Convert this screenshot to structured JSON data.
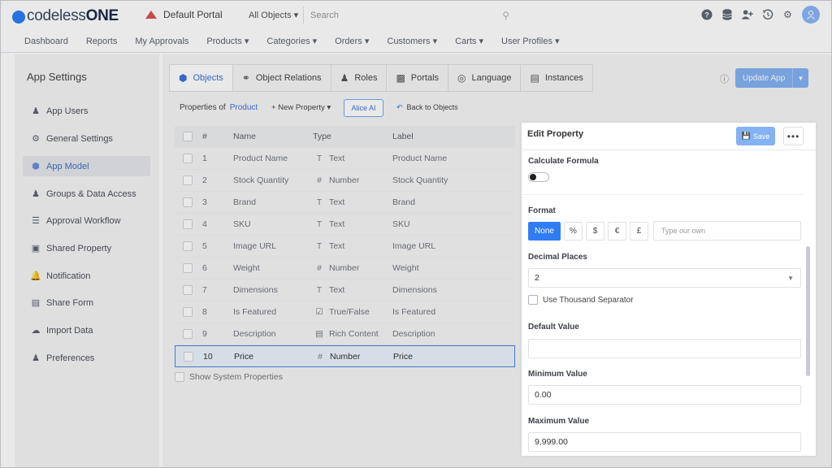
{
  "topbar": {
    "logo_prefix": "codeless",
    "logo_suffix": "ONE",
    "portal": "Default Portal",
    "object_selector": "All Objects ▾",
    "search_placeholder": "Search"
  },
  "nav": [
    "Dashboard",
    "Reports",
    "My Approvals",
    "Products ▾",
    "Categories ▾",
    "Orders ▾",
    "Customers ▾",
    "Carts ▾",
    "User Profiles ▾"
  ],
  "sidebar": {
    "title": "App Settings",
    "items": [
      {
        "label": "App Users",
        "icon": "users-icon"
      },
      {
        "label": "General Settings",
        "icon": "gear-icon"
      },
      {
        "label": "App Model",
        "icon": "cube-icon",
        "active": true
      },
      {
        "label": "Groups & Data Access",
        "icon": "group-icon"
      },
      {
        "label": "Approval Workflow",
        "icon": "list-check-icon"
      },
      {
        "label": "Shared Property",
        "icon": "shared-icon"
      },
      {
        "label": "Notification",
        "icon": "bell-icon"
      },
      {
        "label": "Share Form",
        "icon": "form-icon"
      },
      {
        "label": "Import Data",
        "icon": "cloud-upload-icon"
      },
      {
        "label": "Preferences",
        "icon": "user-settings-icon"
      }
    ]
  },
  "tabs": [
    {
      "label": "Objects",
      "active": true
    },
    {
      "label": "Object Relations"
    },
    {
      "label": "Roles"
    },
    {
      "label": "Portals"
    },
    {
      "label": "Language"
    },
    {
      "label": "Instances"
    }
  ],
  "toolbar": {
    "update_label": "Update App",
    "properties_of": "Properties of",
    "object_name": "Product",
    "new_property": "+ New Property ▾",
    "alice": "Alice AI",
    "back": "Back to Objects"
  },
  "table": {
    "headers": {
      "num": "#",
      "name": "Name",
      "type": "Type",
      "label": "Label"
    },
    "rows": [
      {
        "num": "1",
        "name": "Product Name",
        "type_icon": "T",
        "type": "Text",
        "label": "Product Name"
      },
      {
        "num": "2",
        "name": "Stock Quantity",
        "type_icon": "#",
        "type": "Number",
        "label": "Stock Quantity"
      },
      {
        "num": "3",
        "name": "Brand",
        "type_icon": "T",
        "type": "Text",
        "label": "Brand"
      },
      {
        "num": "4",
        "name": "SKU",
        "type_icon": "T",
        "type": "Text",
        "label": "SKU"
      },
      {
        "num": "5",
        "name": "Image URL",
        "type_icon": "T",
        "type": "Text",
        "label": "Image URL"
      },
      {
        "num": "6",
        "name": "Weight",
        "type_icon": "#",
        "type": "Number",
        "label": "Weight"
      },
      {
        "num": "7",
        "name": "Dimensions",
        "type_icon": "T",
        "type": "Text",
        "label": "Dimensions"
      },
      {
        "num": "8",
        "name": "Is Featured",
        "type_icon": "☑",
        "type": "True/False",
        "label": "Is Featured"
      },
      {
        "num": "9",
        "name": "Description",
        "type_icon": "▤",
        "type": "Rich Content",
        "label": "Description"
      },
      {
        "num": "10",
        "name": "Price",
        "type_icon": "#",
        "type": "Number",
        "label": "Price",
        "selected": true
      }
    ],
    "show_system": "Show System Properties"
  },
  "edit": {
    "title": "Edit Property",
    "save": "Save",
    "more": "•••",
    "calc_label": "Calculate Formula",
    "format_label": "Format",
    "format_options": [
      "None",
      "%",
      "$",
      "€",
      "£"
    ],
    "own_placeholder": "Type our own",
    "decimal_label": "Decimal Places",
    "decimal_value": "2",
    "thousand": "Use Thousand Separator",
    "default_label": "Default Value",
    "default_value": "",
    "min_label": "Minimum Value",
    "min_value": "0.00",
    "max_label": "Maximum Value",
    "max_value": "9,999.00"
  },
  "colors": {
    "accent": "#2f7df2",
    "accent_light": "#84b2f2",
    "alert": "#d9534f"
  }
}
